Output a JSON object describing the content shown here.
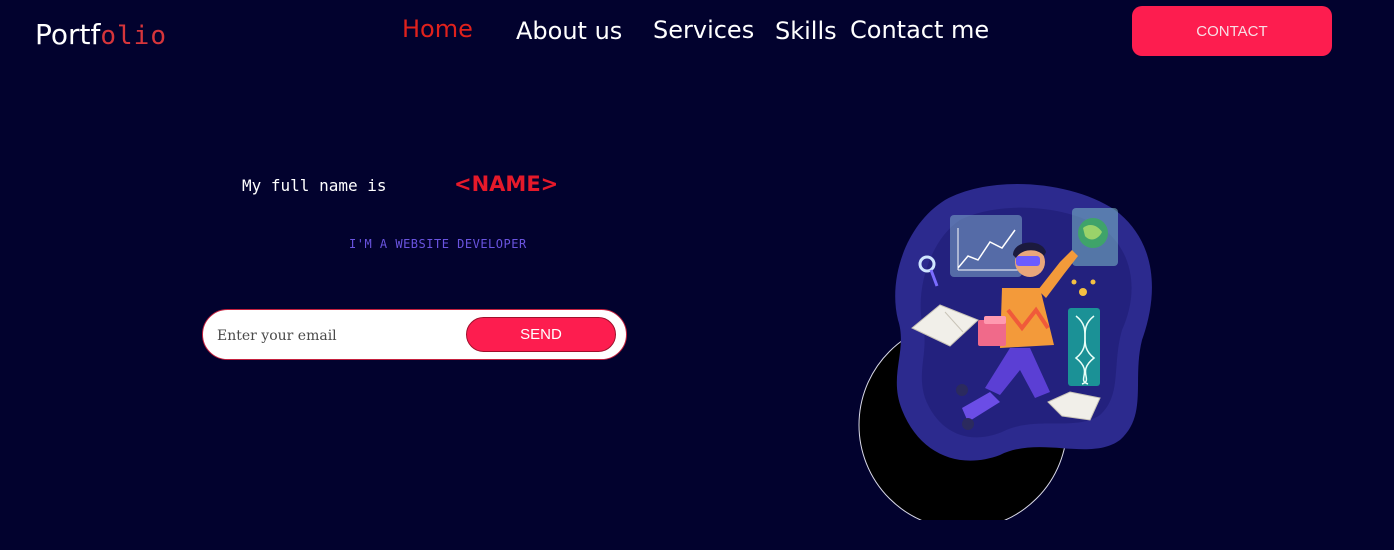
{
  "header": {
    "logo": {
      "part1": "Portf",
      "part2": "olio"
    },
    "nav": [
      {
        "label": "Home",
        "active": true
      },
      {
        "label": "About us",
        "active": false
      },
      {
        "label": "Services",
        "active": false
      },
      {
        "label": "Skills",
        "active": false
      },
      {
        "label": "Contact me",
        "active": false
      }
    ],
    "contact_button": "CONTACT"
  },
  "hero": {
    "intro": "My full name is",
    "name": "<NAME>",
    "role": "I'M A WEBSITE DEVELOPER",
    "email_placeholder": "Enter your email",
    "send_label": "SEND",
    "illustration_icon": "vr-student-illustration"
  },
  "colors": {
    "background": "#02022e",
    "accent": "#fd1d4f",
    "active_nav": "#e0211c",
    "role_text": "#6a54e0"
  }
}
